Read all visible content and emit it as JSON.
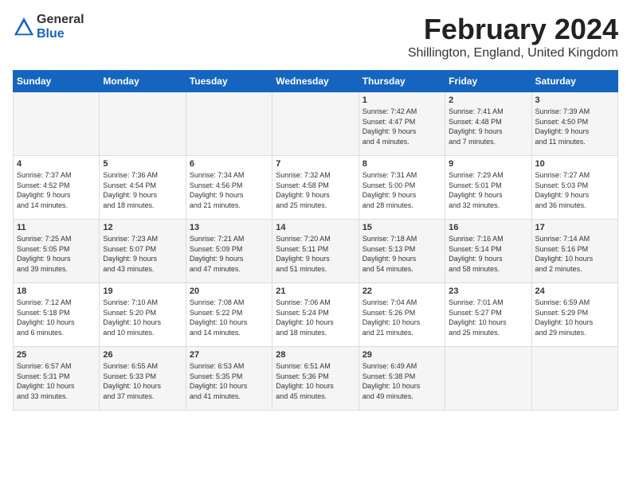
{
  "logo": {
    "text_general": "General",
    "text_blue": "Blue"
  },
  "header": {
    "title": "February 2024",
    "subtitle": "Shillington, England, United Kingdom"
  },
  "columns": [
    "Sunday",
    "Monday",
    "Tuesday",
    "Wednesday",
    "Thursday",
    "Friday",
    "Saturday"
  ],
  "weeks": [
    [
      {
        "day": "",
        "info": ""
      },
      {
        "day": "",
        "info": ""
      },
      {
        "day": "",
        "info": ""
      },
      {
        "day": "",
        "info": ""
      },
      {
        "day": "1",
        "info": "Sunrise: 7:42 AM\nSunset: 4:47 PM\nDaylight: 9 hours\nand 4 minutes."
      },
      {
        "day": "2",
        "info": "Sunrise: 7:41 AM\nSunset: 4:48 PM\nDaylight: 9 hours\nand 7 minutes."
      },
      {
        "day": "3",
        "info": "Sunrise: 7:39 AM\nSunset: 4:50 PM\nDaylight: 9 hours\nand 11 minutes."
      }
    ],
    [
      {
        "day": "4",
        "info": "Sunrise: 7:37 AM\nSunset: 4:52 PM\nDaylight: 9 hours\nand 14 minutes."
      },
      {
        "day": "5",
        "info": "Sunrise: 7:36 AM\nSunset: 4:54 PM\nDaylight: 9 hours\nand 18 minutes."
      },
      {
        "day": "6",
        "info": "Sunrise: 7:34 AM\nSunset: 4:56 PM\nDaylight: 9 hours\nand 21 minutes."
      },
      {
        "day": "7",
        "info": "Sunrise: 7:32 AM\nSunset: 4:58 PM\nDaylight: 9 hours\nand 25 minutes."
      },
      {
        "day": "8",
        "info": "Sunrise: 7:31 AM\nSunset: 5:00 PM\nDaylight: 9 hours\nand 28 minutes."
      },
      {
        "day": "9",
        "info": "Sunrise: 7:29 AM\nSunset: 5:01 PM\nDaylight: 9 hours\nand 32 minutes."
      },
      {
        "day": "10",
        "info": "Sunrise: 7:27 AM\nSunset: 5:03 PM\nDaylight: 9 hours\nand 36 minutes."
      }
    ],
    [
      {
        "day": "11",
        "info": "Sunrise: 7:25 AM\nSunset: 5:05 PM\nDaylight: 9 hours\nand 39 minutes."
      },
      {
        "day": "12",
        "info": "Sunrise: 7:23 AM\nSunset: 5:07 PM\nDaylight: 9 hours\nand 43 minutes."
      },
      {
        "day": "13",
        "info": "Sunrise: 7:21 AM\nSunset: 5:09 PM\nDaylight: 9 hours\nand 47 minutes."
      },
      {
        "day": "14",
        "info": "Sunrise: 7:20 AM\nSunset: 5:11 PM\nDaylight: 9 hours\nand 51 minutes."
      },
      {
        "day": "15",
        "info": "Sunrise: 7:18 AM\nSunset: 5:13 PM\nDaylight: 9 hours\nand 54 minutes."
      },
      {
        "day": "16",
        "info": "Sunrise: 7:16 AM\nSunset: 5:14 PM\nDaylight: 9 hours\nand 58 minutes."
      },
      {
        "day": "17",
        "info": "Sunrise: 7:14 AM\nSunset: 5:16 PM\nDaylight: 10 hours\nand 2 minutes."
      }
    ],
    [
      {
        "day": "18",
        "info": "Sunrise: 7:12 AM\nSunset: 5:18 PM\nDaylight: 10 hours\nand 6 minutes."
      },
      {
        "day": "19",
        "info": "Sunrise: 7:10 AM\nSunset: 5:20 PM\nDaylight: 10 hours\nand 10 minutes."
      },
      {
        "day": "20",
        "info": "Sunrise: 7:08 AM\nSunset: 5:22 PM\nDaylight: 10 hours\nand 14 minutes."
      },
      {
        "day": "21",
        "info": "Sunrise: 7:06 AM\nSunset: 5:24 PM\nDaylight: 10 hours\nand 18 minutes."
      },
      {
        "day": "22",
        "info": "Sunrise: 7:04 AM\nSunset: 5:26 PM\nDaylight: 10 hours\nand 21 minutes."
      },
      {
        "day": "23",
        "info": "Sunrise: 7:01 AM\nSunset: 5:27 PM\nDaylight: 10 hours\nand 25 minutes."
      },
      {
        "day": "24",
        "info": "Sunrise: 6:59 AM\nSunset: 5:29 PM\nDaylight: 10 hours\nand 29 minutes."
      }
    ],
    [
      {
        "day": "25",
        "info": "Sunrise: 6:57 AM\nSunset: 5:31 PM\nDaylight: 10 hours\nand 33 minutes."
      },
      {
        "day": "26",
        "info": "Sunrise: 6:55 AM\nSunset: 5:33 PM\nDaylight: 10 hours\nand 37 minutes."
      },
      {
        "day": "27",
        "info": "Sunrise: 6:53 AM\nSunset: 5:35 PM\nDaylight: 10 hours\nand 41 minutes."
      },
      {
        "day": "28",
        "info": "Sunrise: 6:51 AM\nSunset: 5:36 PM\nDaylight: 10 hours\nand 45 minutes."
      },
      {
        "day": "29",
        "info": "Sunrise: 6:49 AM\nSunset: 5:38 PM\nDaylight: 10 hours\nand 49 minutes."
      },
      {
        "day": "",
        "info": ""
      },
      {
        "day": "",
        "info": ""
      }
    ]
  ]
}
